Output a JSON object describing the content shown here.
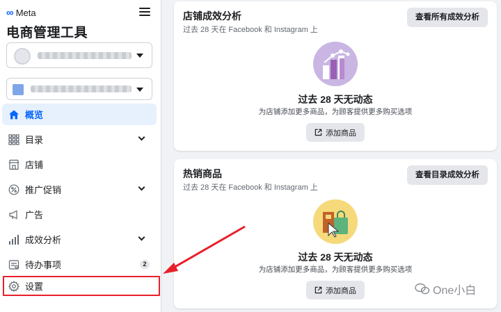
{
  "sidebar": {
    "brand": "Meta",
    "app_title": "电商管理工具",
    "nav": [
      {
        "label": "概览",
        "icon": "home-icon",
        "active": true
      },
      {
        "label": "目录",
        "icon": "grid-icon",
        "chevron": true
      },
      {
        "label": "店铺",
        "icon": "store-icon"
      },
      {
        "label": "推广促销",
        "icon": "percent-icon",
        "chevron": true
      },
      {
        "label": "广告",
        "icon": "megaphone-icon"
      },
      {
        "label": "成效分析",
        "icon": "bar-chart-icon",
        "chevron": true
      },
      {
        "label": "待办事项",
        "icon": "todo-icon",
        "badge": "2"
      },
      {
        "label": "设置",
        "icon": "gear-icon"
      }
    ]
  },
  "cards": [
    {
      "title": "店铺成效分析",
      "subtitle": "过去 28 天在 Facebook 和 Instagram 上",
      "action_button": "查看所有成效分析",
      "empty_title": "过去 28 天无动态",
      "empty_desc": "为店铺添加更多商品，为顾客提供更多购买选项",
      "add_button": "添加商品",
      "illustration": "analytics-chart-illustration"
    },
    {
      "title": "热销商品",
      "subtitle": "过去 28 天在 Facebook 和 Instagram 上",
      "action_button": "查看目录成效分析",
      "empty_title": "过去 28 天无动态",
      "empty_desc": "为店铺添加更多商品，为顾客提供更多购买选项",
      "add_button": "添加商品",
      "illustration": "shopping-bag-illustration"
    }
  ],
  "watermark": "One小白",
  "colors": {
    "accent": "#0866ff",
    "active_bg": "#e7f0fd",
    "highlight": "#e8202a",
    "page_bg": "#f0f2f5"
  }
}
